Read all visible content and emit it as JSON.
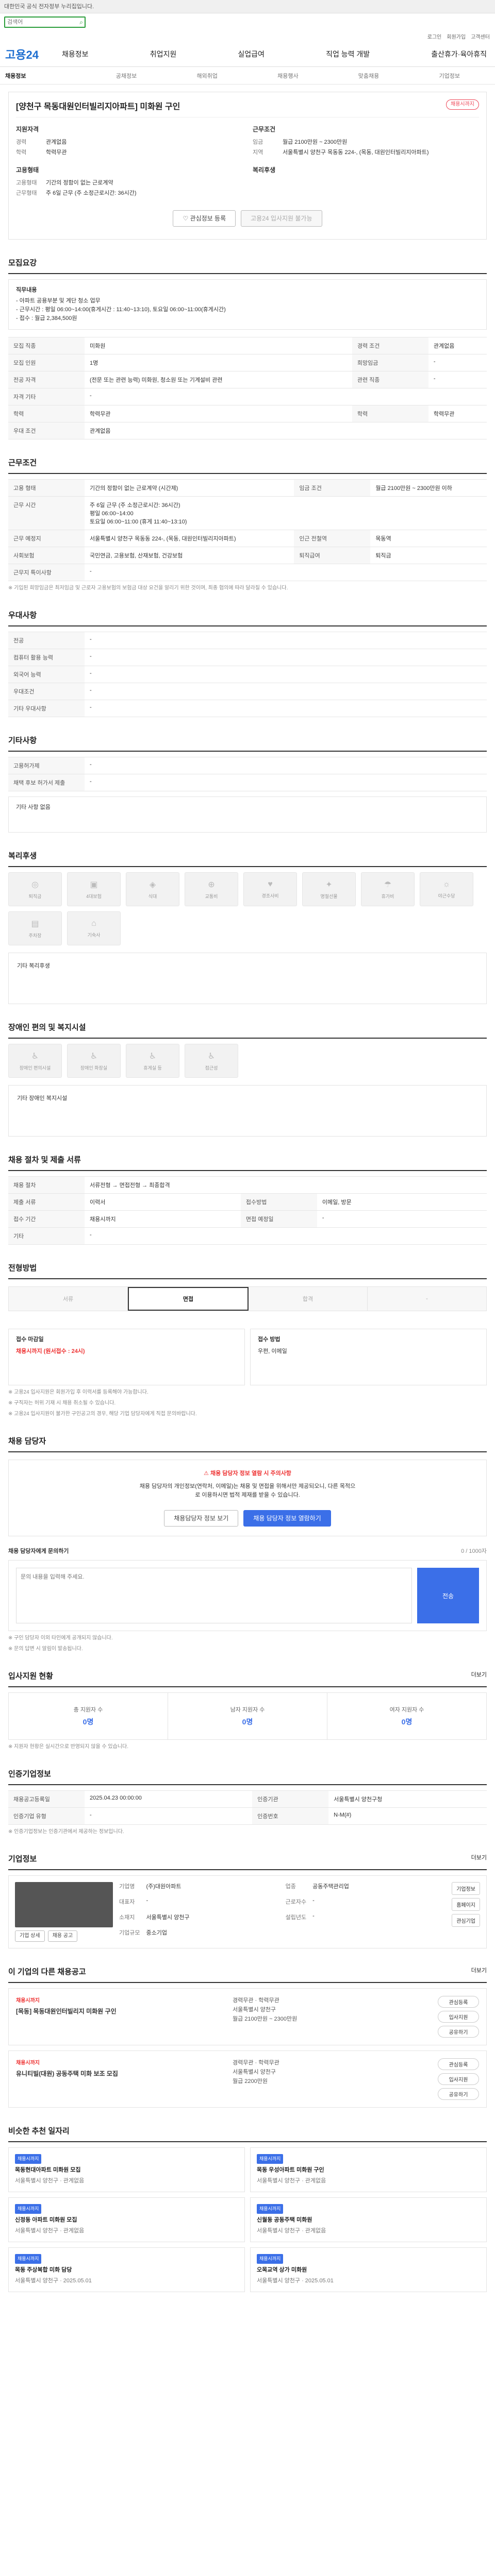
{
  "topbar": {
    "text": "대한민국 공식 전자정부 누리집입니다."
  },
  "search": {
    "value": "",
    "placeholder": "검색어"
  },
  "util": [
    "로그인",
    "회원가입",
    "고객센터"
  ],
  "logo": "고용24",
  "menu": [
    "채용정보",
    "취업지원",
    "실업급여",
    "직업 능력 개발",
    "출산휴가·육아휴직"
  ],
  "subnav": [
    "채용정보",
    "공채정보",
    "해외취업",
    "채용행사",
    "맞춤채용",
    "기업정보"
  ],
  "job": {
    "status": "채용시까지",
    "title": "[양천구 목동대원인터빌리지아파트] 미화원 구인",
    "left_h": "지원자격",
    "right_h": "근무조건",
    "left": [
      {
        "k": "경력",
        "v": "관계없음"
      },
      {
        "k": "학력",
        "v": "학력무관"
      }
    ],
    "right": [
      {
        "k": "임금",
        "v": "월급 2100만원 ~ 2300만원"
      },
      {
        "k": "지역",
        "v": "서울특별시 양천구 목동동 224-, (목동, 대원인터빌리지아파트)"
      }
    ],
    "left2_h": "고용형태",
    "right2_h": "복리후생",
    "left2": [
      {
        "k": "고용형태",
        "v": "기간의 정함이 없는 근로계약"
      },
      {
        "k": "근무형태",
        "v": "주 6일 근무 (주 소정근로시간: 36시간)"
      }
    ],
    "btn_scrap": "관심정보 등록",
    "btn_share": "고용24 입사지원 불가능"
  },
  "s1": {
    "h": "모집요강",
    "box_h": "직무내용",
    "box": [
      "- 아파트 공용부분 및 계단 청소 업무",
      "- 근무시간 : 평일 06:00~14:00(휴게시간 : 11:40~13:10), 토요일 06:00~11:00(휴게시간)",
      "- 접수 : 월급 2,384,500원"
    ],
    "rows": [
      [
        "모집 직종",
        "미화원",
        "경력 조건",
        "관계없음"
      ],
      [
        "모집 인원",
        "1명",
        "희망임금",
        "-"
      ],
      [
        "전공 자격",
        "(전문 또는 관련 능력) 미화원, 청소원 또는 기계설비 관련",
        "관련 직종",
        "-"
      ],
      [
        "자격 기타",
        "-",
        "",
        ""
      ],
      [
        "학력",
        "학력무관",
        "학력",
        "학력무관"
      ],
      [
        "우대 조건",
        "관계없음",
        "",
        ""
      ]
    ]
  },
  "s2": {
    "h": "근무조건",
    "rows": [
      [
        "고용 형태",
        "기간의 정함이 없는 근로계약 (시간제)",
        "임금 조건",
        "월급 2100만원 ~ 2300만원 이하"
      ],
      [
        "근무 시간",
        "주 6일 근무 (주 소정근로시간: 36시간)\n평일 06:00~14:00\n토요일 06:00~11:00 (휴게 11:40~13:10)",
        "",
        ""
      ],
      [
        "근무 예정지",
        "서울특별시 양천구 목동동 224-, (목동, 대원인터빌리지아파트)",
        "인근 전철역",
        "목동역"
      ],
      [
        "사회보험",
        "국민연금, 고용보험, 산재보험, 건강보험",
        "퇴직급여",
        "퇴직금"
      ],
      [
        "근무지 특이사항",
        "-",
        "",
        ""
      ]
    ],
    "note": "※ 기입된 희망임금은 최저임금 및 근로자 고용보험의 보험금 대상 요건을 알리기 위한 것이며, 최종 협의에 따라 달라질 수 있습니다."
  },
  "s3": {
    "h": "우대사항",
    "rows": [
      [
        "전공",
        "-"
      ],
      [
        "컴퓨터 활용 능력",
        "-"
      ],
      [
        "외국어 능력",
        "-"
      ],
      [
        "우대조건",
        "-"
      ],
      [
        "기타 우대사항",
        "-"
      ]
    ]
  },
  "s4": {
    "h": "기타사항",
    "rows": [
      [
        "고용허가제",
        "-"
      ],
      [
        "채택 후보 허가서 제출",
        "-"
      ]
    ],
    "box": "기타 사항 없음"
  },
  "s5": {
    "h": "복리후생",
    "items": [
      "퇴직금",
      "4대보험",
      "식대",
      "교통비",
      "경조사비",
      "명절선물",
      "휴가비",
      "야근수당",
      "주차장",
      "기숙사"
    ],
    "text": "기타 복리후생"
  },
  "s6": {
    "h": "장애인 편의 및 복지시설",
    "items": [
      "장애인 편의시설",
      "장애인 화장실",
      "휴게실 등",
      "접근성"
    ],
    "text": "기타 장애인 복지시설"
  },
  "s7": {
    "h": "채용 절차 및 제출 서류",
    "rows": [
      [
        "채용 절차",
        "서류전형 → 면접전형 → 최종합격"
      ],
      [
        "제출 서류",
        "이력서",
        "접수방법",
        "이메일, 방문"
      ],
      [
        "접수 기간",
        "채용시까지",
        "면접 예정일",
        "-"
      ],
      [
        "기타",
        "-",
        "",
        ""
      ]
    ]
  },
  "s8": {
    "h": "전형방법",
    "steps": [
      "서류",
      "면접",
      "합격",
      "-"
    ]
  },
  "s9": {
    "h": "접수 마감일",
    "box1_h": "접수 마감일",
    "box1": "채용시까지 (원서접수 : 24시)",
    "box2_h": "접수 방법",
    "box2": "우편, 이메일",
    "notes": [
      "※ 고용24 입사지원은 회원가입 후 이력서를 등록해야 가능합니다.",
      "※ 구직자는 허위 기재 시 채용 취소될 수 있습니다.",
      "※ 고용24 입사지원이 불가한 구인공고의 경우, 해당 기업 담당자에게 직접 문의바랍니다."
    ]
  },
  "s10": {
    "h": "채용 담당자",
    "alert_red": "채용 담당자 정보 열람 시 주의사항",
    "alert": "채용 담당자의 개인정보(연락처, 이메일)는 채용 및 면접을 위해서만 제공되오니, 다른 목적으로 이용하시면 법적 제재를 받을 수 있습니다.",
    "btn1": "채용담당자 정보 보기",
    "btn2": "채용 담당자 정보 열람하기"
  },
  "s11": {
    "h": "채용 담당자에게 문의하기",
    "counter": "0 / 1000자",
    "placeholder": "문의 내용을 입력해 주세요.",
    "send": "전송",
    "notes": [
      "※ 구인 담당자 이외 타인에게 공개되지 않습니다.",
      "※ 문의 답변 시 알림이 발송됩니다."
    ]
  },
  "s12": {
    "h": "입사지원 현황",
    "more": "더보기",
    "stats": [
      {
        "k": "총 지원자 수",
        "v": "0명"
      },
      {
        "k": "남자 지원자 수",
        "v": "0명"
      },
      {
        "k": "여자 지원자 수",
        "v": "0명"
      }
    ],
    "note": "※ 지원자 현황은 실시간으로 반영되지 않을 수 있습니다."
  },
  "s13": {
    "h": "인증기업정보",
    "rows": [
      [
        "채용공고등록일",
        "2025.04.23 00:00:00",
        "인증기관",
        "서울특별시 양천구청"
      ],
      [
        "인증기업 유형",
        "-",
        "인증번호",
        "N-M(#)"
      ]
    ],
    "note": "※ 인증기업정보는 인증기관에서 제공하는 정보입니다."
  },
  "s14": {
    "h": "기업정보",
    "more": "더보기",
    "rows": [
      [
        "기업명",
        "(주)대원아파트",
        "업종",
        "공동주택관리업"
      ],
      [
        "대표자",
        "-",
        "근로자수",
        "-"
      ],
      [
        "소재지",
        "서울특별시 양천구",
        "설립년도",
        "-"
      ],
      [
        "기업규모",
        "중소기업",
        "",
        ""
      ]
    ],
    "btns": [
      "기업정보",
      "홈페이지",
      "관심기업"
    ],
    "logobtns": [
      "기업 상세",
      "채용 공고"
    ]
  },
  "s15": {
    "h": "이 기업의 다른 채용공고",
    "more": "더보기",
    "jobs": [
      {
        "tag": "채용시까지",
        "comp": "[목동] 목동대원인터빌리지 미화원 구인",
        "meta": [
          "경력무관 · 학력무관",
          "서울특별시 양천구",
          "월급 2100만원 ~ 2300만원"
        ],
        "btns": [
          "관심등록",
          "입사지원",
          "공유하기"
        ]
      },
      {
        "tag": "채용시까지",
        "comp": "유니티빌(대원) 공동주택 미화 보조 모집",
        "meta": [
          "경력무관 · 학력무관",
          "서울특별시 양천구",
          "월급 2200만원"
        ],
        "btns": [
          "관심등록",
          "입사지원",
          "공유하기"
        ]
      }
    ]
  },
  "s16": {
    "h": "비슷한 추천 일자리",
    "items": [
      {
        "tag": "채용시까지",
        "title": "목동현대아파트 미화원 모집",
        "meta": "서울특별시 양천구 · 관계없음"
      },
      {
        "tag": "채용시까지",
        "title": "목동 우성아파트 미화원 구인",
        "meta": "서울특별시 양천구 · 관계없음"
      },
      {
        "tag": "채용시까지",
        "title": "신정동 아파트 미화원 모집",
        "meta": "서울특별시 양천구 · 관계없음"
      },
      {
        "tag": "채용시까지",
        "title": "신월동 공동주택 미화원",
        "meta": "서울특별시 양천구 · 관계없음"
      },
      {
        "tag": "채용시까지",
        "title": "목동 주상복합 미화 담당",
        "meta": "서울특별시 양천구 · 2025.05.01"
      },
      {
        "tag": "채용시까지",
        "title": "오목교역 상가 미화원",
        "meta": "서울특별시 양천구 · 2025.05.01"
      }
    ]
  }
}
